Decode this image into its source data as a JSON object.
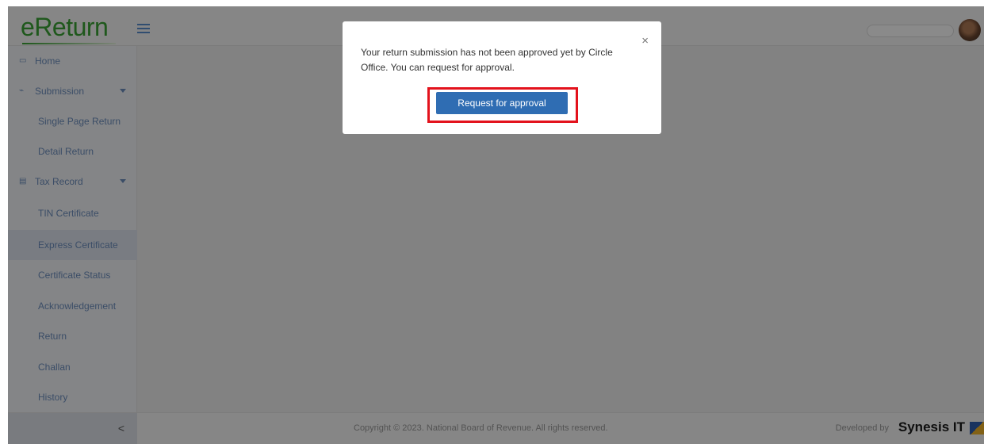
{
  "header": {
    "logo_text": "eReturn",
    "menu_icon": "hamburger-icon",
    "search_placeholder": ""
  },
  "sidebar": {
    "items": [
      {
        "label": "Home",
        "icon": "home-icon",
        "type": "top"
      },
      {
        "label": "Submission",
        "icon": "submission-icon",
        "type": "top",
        "expandable": true
      },
      {
        "label": "Single Page Return",
        "type": "sub"
      },
      {
        "label": "Detail Return",
        "type": "sub"
      },
      {
        "label": "Tax Record",
        "icon": "tax-record-icon",
        "type": "top",
        "expandable": true
      },
      {
        "label": "TIN Certificate",
        "type": "sub"
      },
      {
        "label": "Express Certificate",
        "type": "sub",
        "active": true
      },
      {
        "label": "Certificate Status",
        "type": "sub"
      },
      {
        "label": "Acknowledgement",
        "type": "sub"
      },
      {
        "label": "Return",
        "type": "sub"
      },
      {
        "label": "Challan",
        "type": "sub"
      },
      {
        "label": "History",
        "type": "sub"
      }
    ],
    "collapse_label": "<"
  },
  "footer": {
    "copyright": "Copyright © 2023. National Board of Revenue. All rights reserved.",
    "developed_by": "Developed by",
    "brand": "Synesis IT"
  },
  "modal": {
    "message": "Your return submission has not been approved yet by Circle Office. You can request for approval.",
    "close_label": "×",
    "button_label": "Request for approval"
  },
  "colors": {
    "brand_green": "#3aa335",
    "primary_button": "#2f6db3",
    "highlight_red": "#e3121c",
    "sidebar_text": "#6d8fbf"
  }
}
